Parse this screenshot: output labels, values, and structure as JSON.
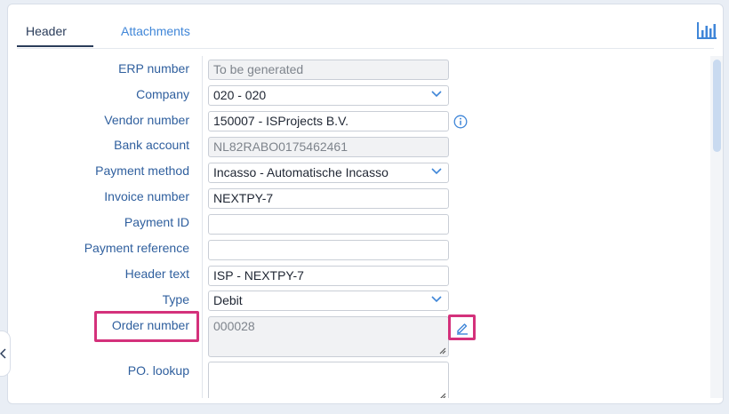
{
  "tabs": {
    "header": "Header",
    "attachments": "Attachments"
  },
  "icons": {
    "chart": "bar-chart-icon",
    "info": "info-icon",
    "edit": "pencil-edit-icon",
    "chevron": "chevron-down-icon",
    "collapse": "chevron-left-icon"
  },
  "colors": {
    "accent": "#3f86d8",
    "label": "#2f5f9e",
    "highlight": "#d4317b"
  },
  "form": {
    "erp_number": {
      "label": "ERP number",
      "value": "To be generated"
    },
    "company": {
      "label": "Company",
      "value": "020 - 020"
    },
    "vendor_number": {
      "label": "Vendor number",
      "value": "150007 - ISProjects B.V."
    },
    "bank_account": {
      "label": "Bank account",
      "value": "NL82RABO0175462461"
    },
    "payment_method": {
      "label": "Payment method",
      "value": "Incasso - Automatische Incasso"
    },
    "invoice_number": {
      "label": "Invoice number",
      "value": "NEXTPY-7"
    },
    "payment_id": {
      "label": "Payment ID",
      "value": ""
    },
    "payment_reference": {
      "label": "Payment reference",
      "value": ""
    },
    "header_text": {
      "label": "Header text",
      "value": "ISP - NEXTPY-7"
    },
    "type": {
      "label": "Type",
      "value": "Debit"
    },
    "order_number": {
      "label": "Order number",
      "value": "000028"
    },
    "po_lookup": {
      "label": "PO. lookup",
      "value": ""
    }
  }
}
